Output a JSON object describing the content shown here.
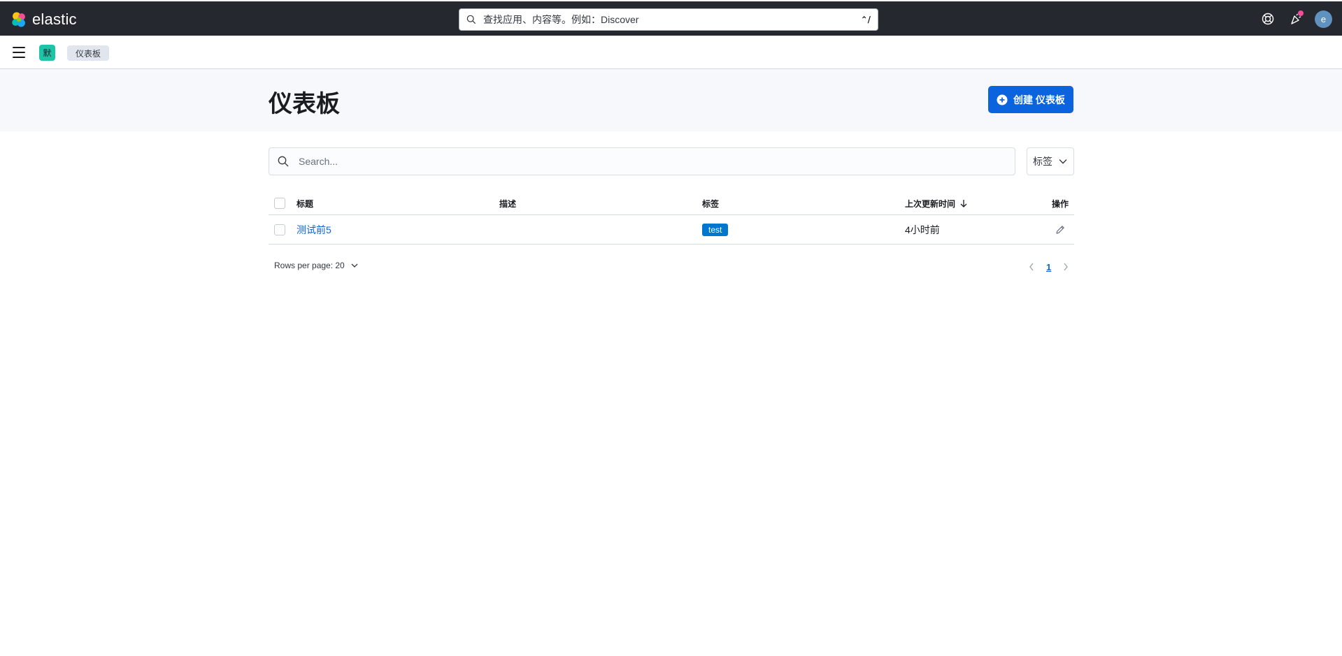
{
  "header": {
    "brand": "elastic",
    "search_placeholder": "查找应用、内容等。例如：Discover",
    "search_shortcut": "⌃/",
    "avatar_initial": "e"
  },
  "breadcrumbs": {
    "space_initial": "默",
    "current": "仪表板"
  },
  "page": {
    "title": "仪表板",
    "create_button": "创建 仪表板"
  },
  "filters": {
    "search_placeholder": "Search...",
    "tags_label": "标签"
  },
  "table": {
    "columns": {
      "title": "标题",
      "description": "描述",
      "tags": "标签",
      "updated": "上次更新时间",
      "actions": "操作"
    },
    "rows": [
      {
        "title": "测试前5",
        "description": "",
        "tag": "test",
        "updated": "4小时前"
      }
    ]
  },
  "pagination": {
    "rows_per_page": "Rows per page: 20",
    "current_page": "1"
  },
  "colors": {
    "header_bg": "#25282f",
    "primary": "#0b64dd",
    "tag_bg": "#0077cc",
    "space_badge": "#1ec4a8",
    "notification_dot": "#f04e98"
  }
}
